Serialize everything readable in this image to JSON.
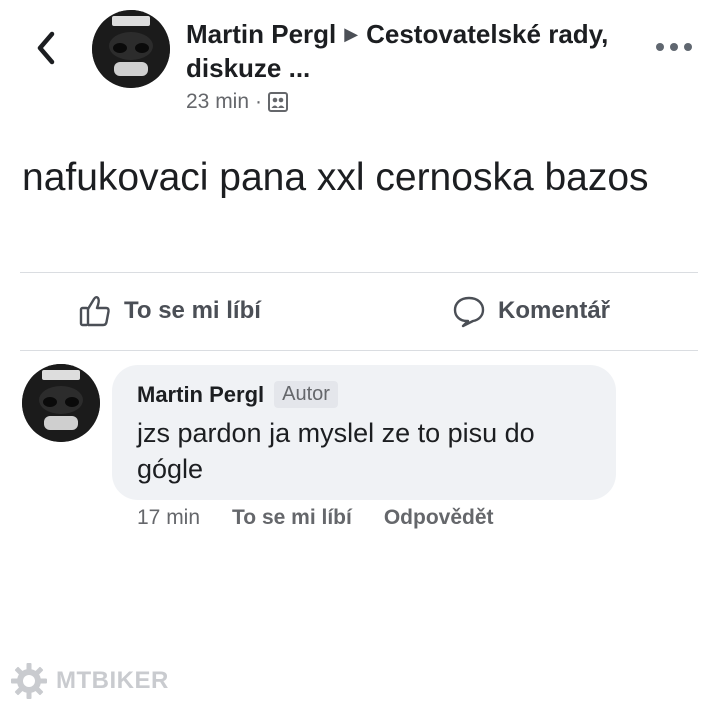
{
  "post": {
    "author": "Martin Pergl",
    "group": "Cestovatelské rady, diskuze ...",
    "time": "23 min",
    "separator": "·",
    "text": "nafukovaci pana xxl cernoska bazos"
  },
  "actions": {
    "like_label": "To se mi líbí",
    "comment_label": "Komentář"
  },
  "comment": {
    "author": "Martin Pergl",
    "badge": "Autor",
    "text": "jzs pardon ja myslel ze to pisu do gógle",
    "time": "17 min",
    "like_label": "To se mi líbí",
    "reply_label": "Odpovědět"
  },
  "watermark": {
    "text": "MTBIKER"
  },
  "icons": {
    "back": "chevron-left-icon",
    "more": "more-dots-icon",
    "audience": "group-audience-icon",
    "like": "thumbs-up-icon",
    "comment": "speech-bubble-icon",
    "watermark": "gear-logo-icon"
  },
  "colors": {
    "text": "#1c1e21",
    "secondary": "#65676b",
    "bubble": "#f0f2f5",
    "divider": "#dadde1"
  }
}
